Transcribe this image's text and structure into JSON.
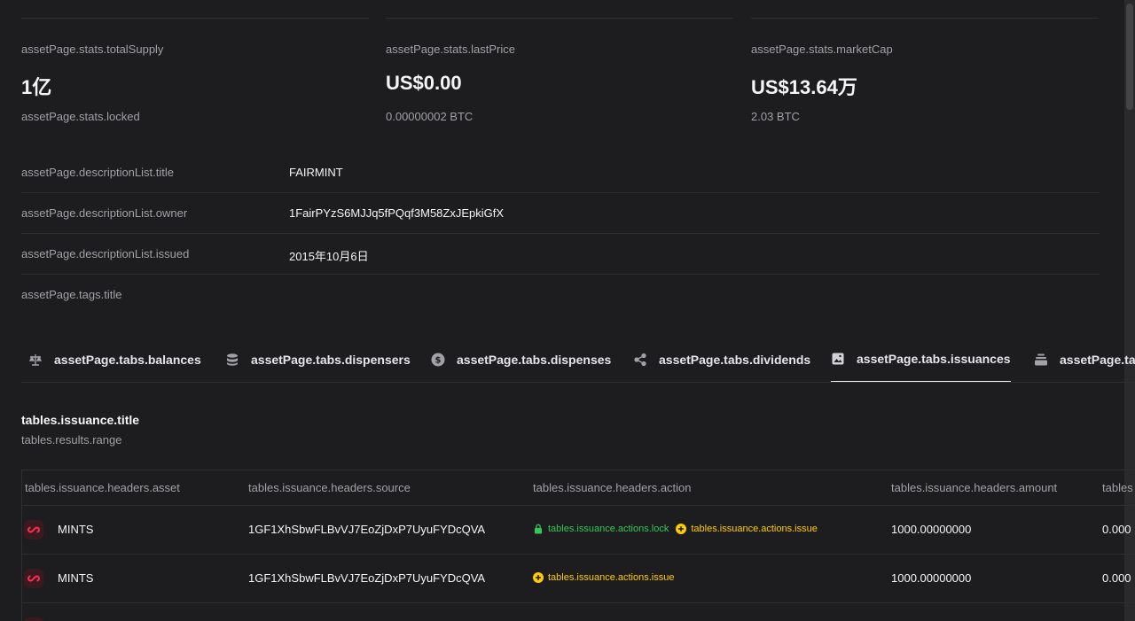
{
  "stats": [
    {
      "label": "assetPage.stats.totalSupply",
      "value": "1亿",
      "sub": "assetPage.stats.locked"
    },
    {
      "label": "assetPage.stats.lastPrice",
      "value": "US$0.00",
      "sub": "0.00000002 BTC"
    },
    {
      "label": "assetPage.stats.marketCap",
      "value": "US$13.64万",
      "sub": "2.03 BTC"
    }
  ],
  "descriptionList": [
    {
      "term": "assetPage.descriptionList.title",
      "value": "FAIRMINT"
    },
    {
      "term": "assetPage.descriptionList.owner",
      "value": "1FairPYzS6MJJq5fPQqf3M58ZxJEpkiGfX"
    },
    {
      "term": "assetPage.descriptionList.issued",
      "value": "2015年10月6日"
    },
    {
      "term": "assetPage.tags.title",
      "value": ""
    }
  ],
  "tabs": [
    {
      "label": "assetPage.tabs.balances",
      "icon": "scale-icon"
    },
    {
      "label": "assetPage.tabs.dispensers",
      "icon": "database-icon"
    },
    {
      "label": "assetPage.tabs.dispenses",
      "icon": "dollar-coin-icon"
    },
    {
      "label": "assetPage.tabs.dividends",
      "icon": "share-icon"
    },
    {
      "label": "assetPage.tabs.issuances",
      "icon": "image-icon",
      "active": true
    },
    {
      "label": "assetPage.tabs.ta",
      "icon": "stack-icon"
    }
  ],
  "table": {
    "title": "tables.issuance.title",
    "subtitle": "tables.results.range",
    "headers": [
      "tables.issuance.headers.asset",
      "tables.issuance.headers.source",
      "tables.issuance.headers.action",
      "tables.issuance.headers.amount",
      "tables"
    ],
    "rows": [
      {
        "asset": "MINTS",
        "source": "1GF1XhSbwFLBvVJ7EoZjDxP7UyuFYDcQVA",
        "actions": [
          {
            "type": "lock",
            "label": "tables.issuance.actions.lock"
          },
          {
            "type": "issue",
            "label": "tables.issuance.actions.issue"
          }
        ],
        "amount": "1000.00000000",
        "extra": "0.000"
      },
      {
        "asset": "MINTS",
        "source": "1GF1XhSbwFLBvVJ7EoZjDxP7UyuFYDcQVA",
        "actions": [
          {
            "type": "issue",
            "label": "tables.issuance.actions.issue"
          }
        ],
        "amount": "1000.00000000",
        "extra": "0.000"
      }
    ]
  },
  "colors": {
    "background": "#1d1d1f",
    "lock": "#34c759",
    "issue": "#ffcc00",
    "assetIcon": "#ff2d55"
  }
}
